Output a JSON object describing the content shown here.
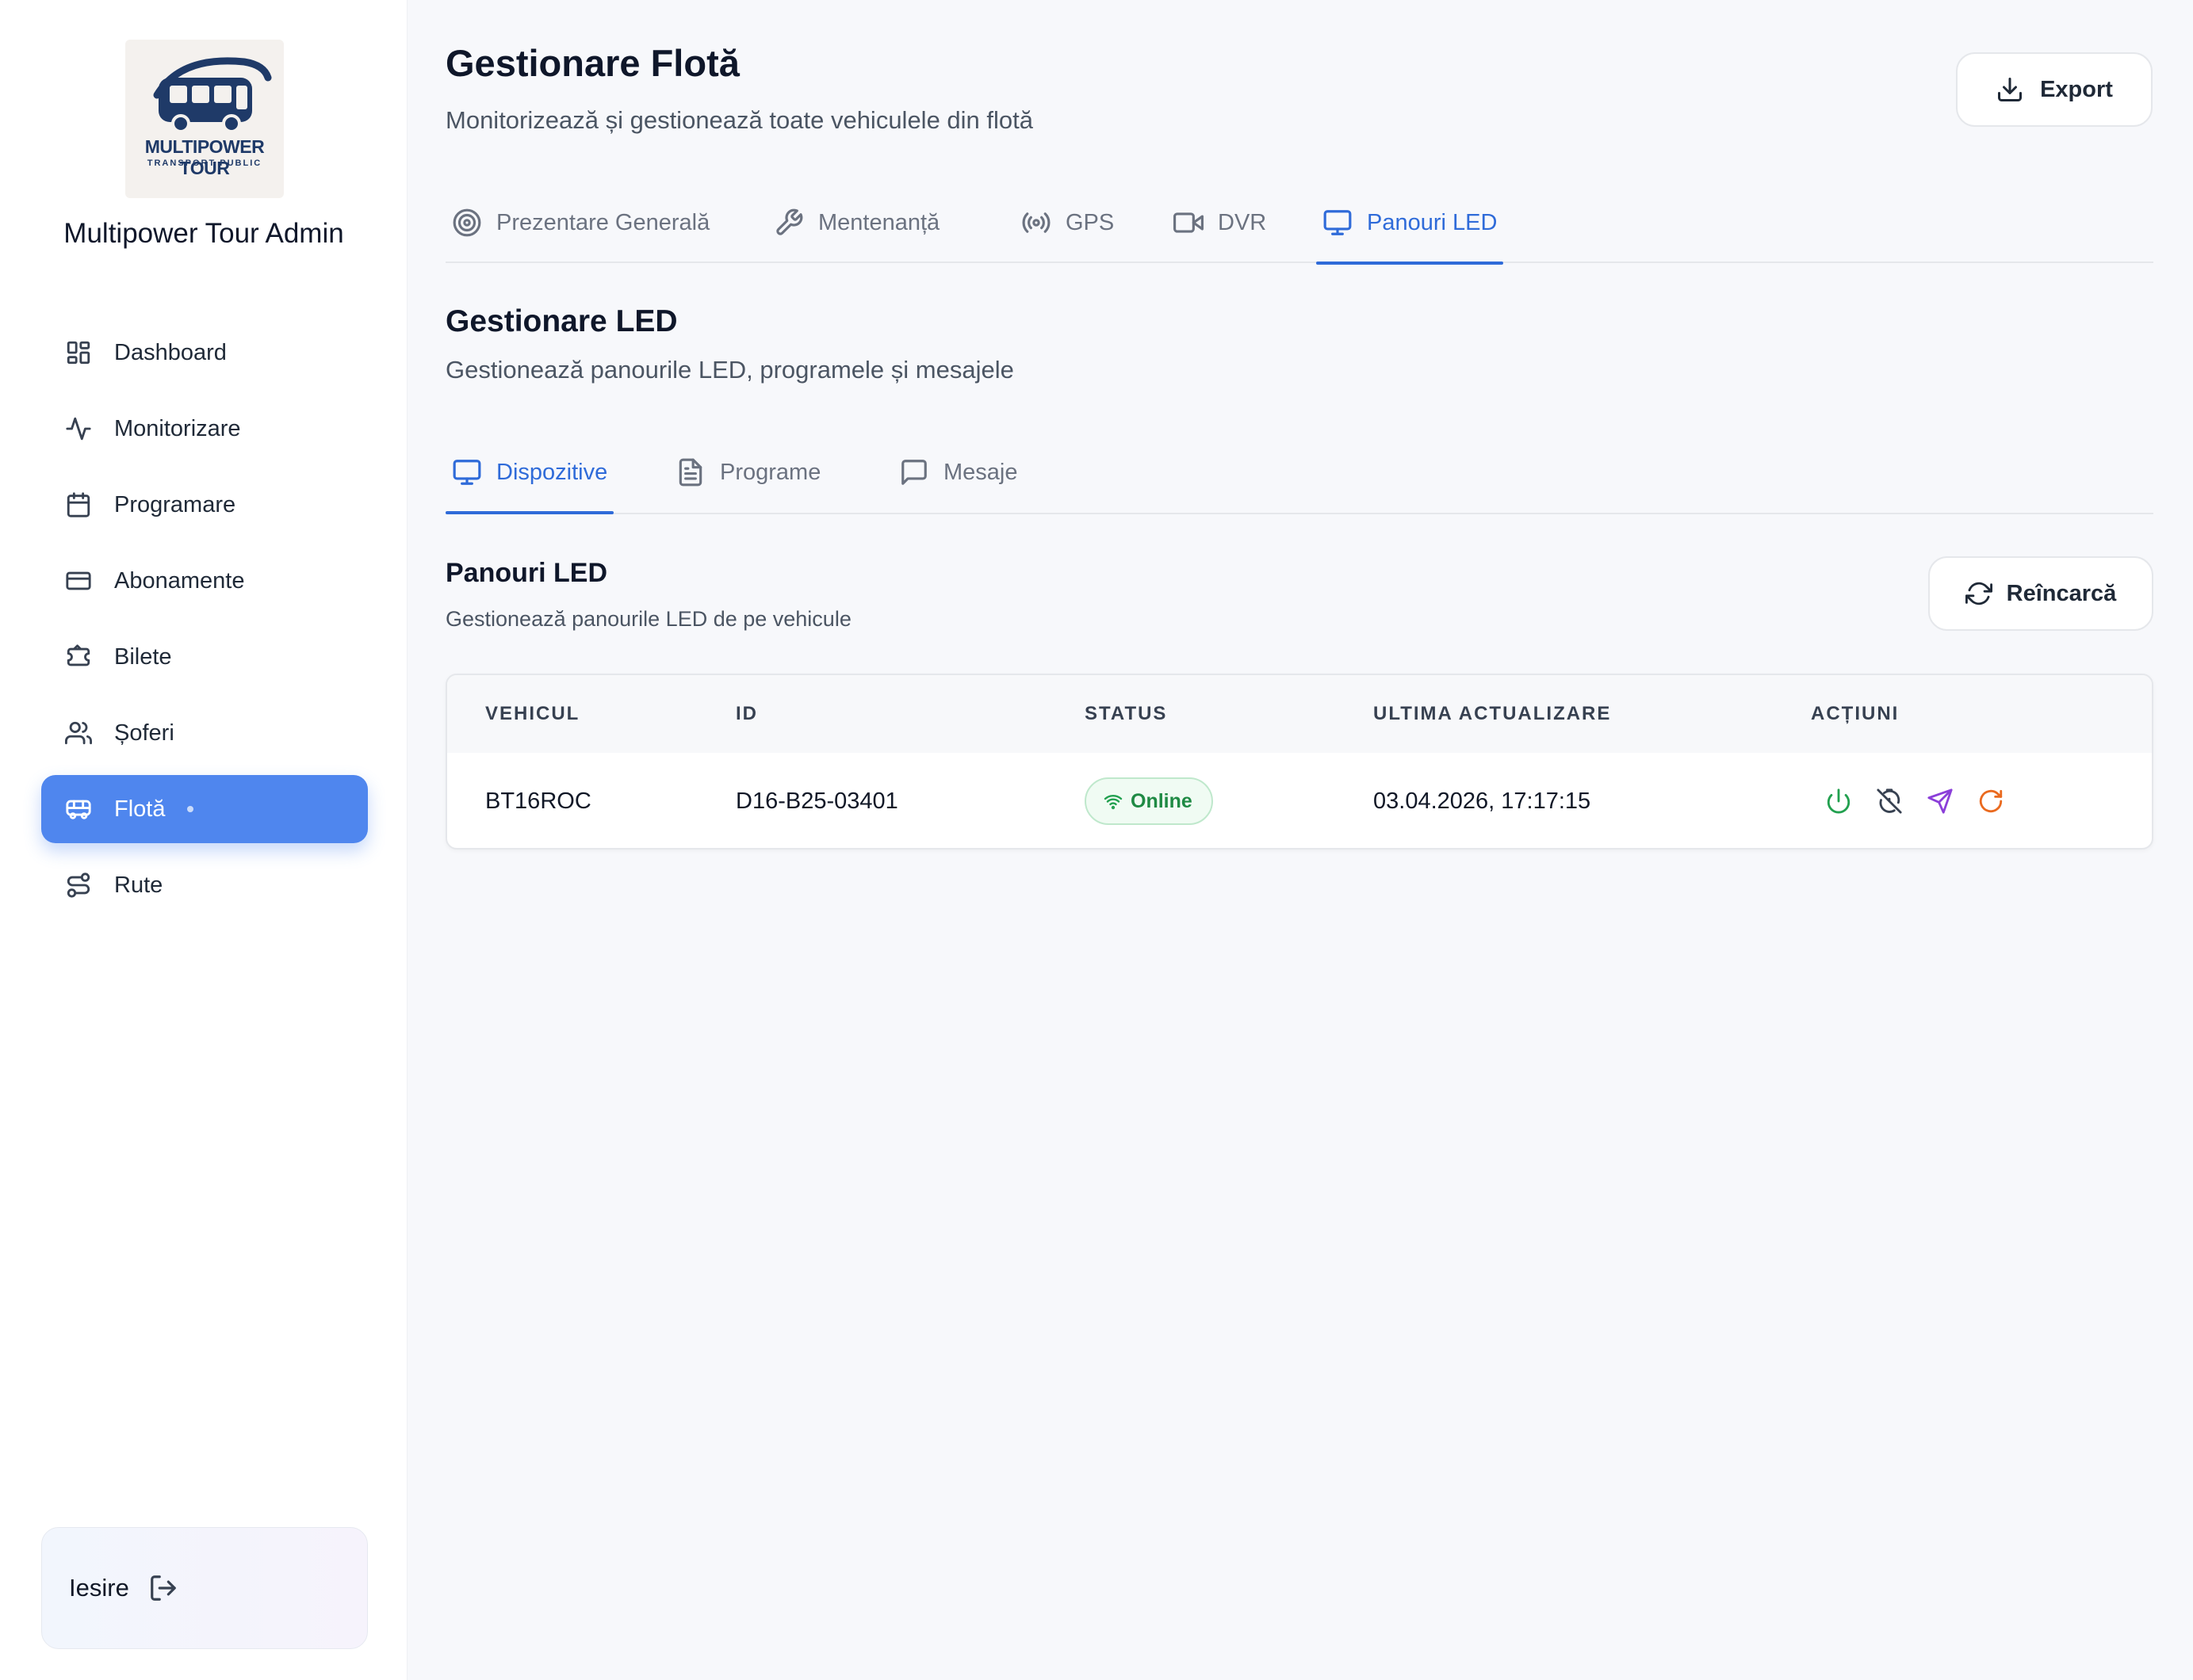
{
  "sidebar": {
    "logo": {
      "line1": "MULTIPOWER TOUR",
      "line2": "TRANSPORT PUBLIC"
    },
    "brand": "Multipower Tour Admin",
    "items": [
      {
        "label": "Dashboard",
        "icon": "dashboard-icon"
      },
      {
        "label": "Monitorizare",
        "icon": "activity-icon"
      },
      {
        "label": "Programare",
        "icon": "calendar-icon"
      },
      {
        "label": "Abonamente",
        "icon": "credit-card-icon"
      },
      {
        "label": "Bilete",
        "icon": "ticket-icon"
      },
      {
        "label": "Șoferi",
        "icon": "users-icon"
      },
      {
        "label": "Flotă",
        "icon": "bus-icon",
        "active": true
      },
      {
        "label": "Rute",
        "icon": "route-icon"
      }
    ],
    "logout": "Iesire"
  },
  "header": {
    "title": "Gestionare Flotă",
    "subtitle": "Monitorizează și gestionează toate vehiculele din flotă",
    "export_label": "Export"
  },
  "tabs": [
    {
      "label": "Prezentare Generală",
      "icon": "target-icon"
    },
    {
      "label": "Mentenanță",
      "icon": "wrench-icon"
    },
    {
      "label": "GPS",
      "icon": "radio-icon"
    },
    {
      "label": "DVR",
      "icon": "video-icon"
    },
    {
      "label": "Panouri LED",
      "icon": "monitor-icon",
      "active": true
    }
  ],
  "led": {
    "title": "Gestionare LED",
    "subtitle": "Gestionează panourile LED, programele și mesajele",
    "subtabs": [
      {
        "label": "Dispozitive",
        "icon": "monitor-icon",
        "active": true
      },
      {
        "label": "Programe",
        "icon": "file-text-icon"
      },
      {
        "label": "Mesaje",
        "icon": "message-icon"
      }
    ]
  },
  "panel": {
    "title": "Panouri LED",
    "subtitle": "Gestionează panourile LED de pe vehicule",
    "reload_label": "Reîncarcă",
    "columns": [
      "VEHICUL",
      "ID",
      "STATUS",
      "ULTIMA ACTUALIZARE",
      "ACȚIUNI"
    ],
    "rows": [
      {
        "vehicle": "BT16ROC",
        "id": "D16-B25-03401",
        "status": "Online",
        "updated": "03.04.2026, 17:17:15",
        "actions": [
          "power-icon",
          "timer-off-icon",
          "send-icon",
          "refresh-icon"
        ]
      }
    ]
  },
  "colors": {
    "accent": "#4f86ee",
    "tab_active": "#2f6bd9",
    "online": "#1f8a44",
    "action_power": "#22a04f",
    "action_send": "#8b3fd9",
    "action_refresh": "#ea6a1f"
  }
}
